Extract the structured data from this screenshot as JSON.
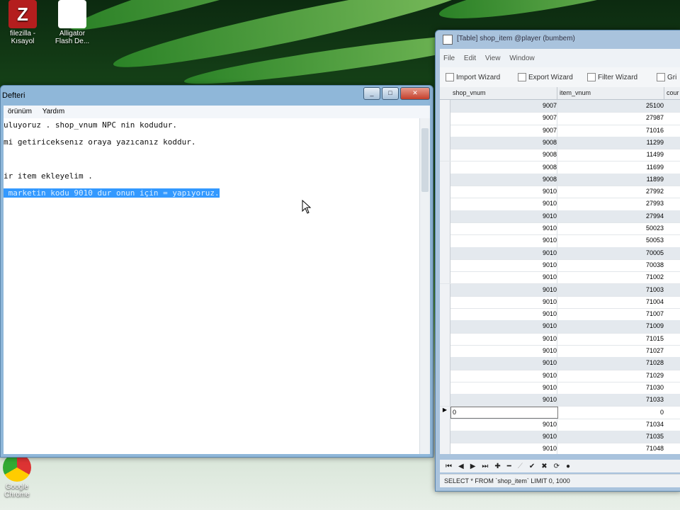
{
  "desktop": {
    "icons": [
      {
        "name": "filezilla",
        "label_line1": "filezilla -",
        "label_line2": "Kısayol"
      },
      {
        "name": "alligator",
        "label_line1": "Alligator",
        "label_line2": "Flash De..."
      },
      {
        "name": "google-chrome",
        "label_line1": "Google",
        "label_line2": "Chrome"
      }
    ]
  },
  "notepad": {
    "title": "Defteri",
    "menu": [
      "örünüm",
      "Yardım"
    ],
    "lines": [
      "uluyoruz . shop_vnum NPC nin kodudur.",
      "mi getiriceksenız oraya yazıcanız koddur.",
      "",
      "ir item ekleyelim .",
      " marketin kodu 9010 dur onun için = yapıyoruz."
    ]
  },
  "table_window": {
    "title": "[Table] shop_item @player (bumbem)",
    "menu": [
      "File",
      "Edit",
      "View",
      "Window"
    ],
    "toolbar": {
      "import": "Import Wizard",
      "export": "Export Wizard",
      "filter": "Filter Wizard",
      "grid": "Gri"
    },
    "columns": [
      "shop_vnum",
      "item_vnum",
      "cour"
    ],
    "rows": [
      [
        "9007",
        "25100"
      ],
      [
        "9007",
        "27987"
      ],
      [
        "9007",
        "71016"
      ],
      [
        "9008",
        "11299"
      ],
      [
        "9008",
        "11499"
      ],
      [
        "9008",
        "11699"
      ],
      [
        "9008",
        "11899"
      ],
      [
        "9010",
        "27992"
      ],
      [
        "9010",
        "27993"
      ],
      [
        "9010",
        "27994"
      ],
      [
        "9010",
        "50023"
      ],
      [
        "9010",
        "50053"
      ],
      [
        "9010",
        "70005"
      ],
      [
        "9010",
        "70038"
      ],
      [
        "9010",
        "71002"
      ],
      [
        "9010",
        "71003"
      ],
      [
        "9010",
        "71004"
      ],
      [
        "9010",
        "71007"
      ],
      [
        "9010",
        "71009"
      ],
      [
        "9010",
        "71015"
      ],
      [
        "9010",
        "71027"
      ],
      [
        "9010",
        "71028"
      ],
      [
        "9010",
        "71029"
      ],
      [
        "9010",
        "71030"
      ],
      [
        "9010",
        "71033"
      ],
      [
        "0",
        "0"
      ],
      [
        "9010",
        "71034"
      ],
      [
        "9010",
        "71035"
      ],
      [
        "9010",
        "71048"
      ]
    ],
    "edit_row_index": 25,
    "status": "SELECT * FROM `shop_item` LIMIT 0, 1000"
  }
}
